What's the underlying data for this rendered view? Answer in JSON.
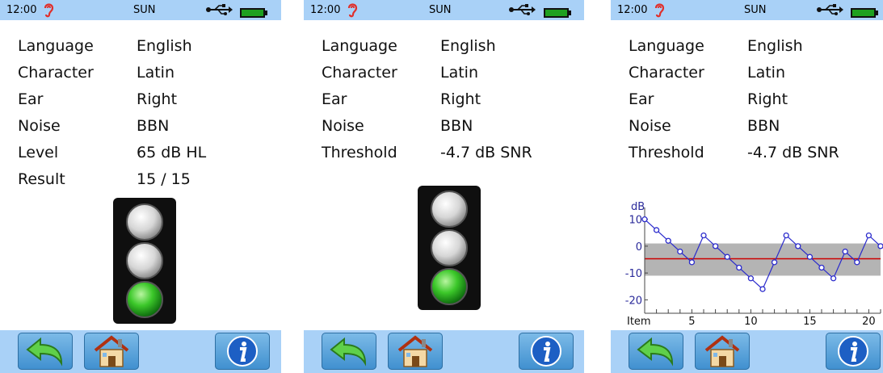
{
  "status": {
    "time": "12:00",
    "day": "SUN",
    "ear_icon": "ear-icon",
    "usb_icon": "usb-icon",
    "battery_color": "#1a8a1a"
  },
  "screen1": {
    "rows": [
      {
        "label": "Language",
        "value": "English"
      },
      {
        "label": "Character",
        "value": "Latin"
      },
      {
        "label": "Ear",
        "value": "Right"
      },
      {
        "label": "Noise",
        "value": "BBN"
      },
      {
        "label": "Level",
        "value": "65 dB HL"
      },
      {
        "label": "Result",
        "value": "15 / 15"
      }
    ],
    "traffic_light": [
      "off",
      "off",
      "green"
    ]
  },
  "screen2": {
    "rows": [
      {
        "label": "Language",
        "value": "English"
      },
      {
        "label": "Character",
        "value": "Latin"
      },
      {
        "label": "Ear",
        "value": "Right"
      },
      {
        "label": "Noise",
        "value": "BBN"
      },
      {
        "label": "Threshold",
        "value": "-4.7 dB SNR"
      }
    ],
    "traffic_light": [
      "off",
      "off",
      "green"
    ]
  },
  "screen3": {
    "rows": [
      {
        "label": "Language",
        "value": "English"
      },
      {
        "label": "Character",
        "value": "Latin"
      },
      {
        "label": "Ear",
        "value": "Right"
      },
      {
        "label": "Noise",
        "value": "BBN"
      },
      {
        "label": "Threshold",
        "value": "-4.7 dB SNR"
      }
    ]
  },
  "toolbar": {
    "back_icon": "back-arrow-icon",
    "home_icon": "home-icon",
    "info_icon": "info-icon"
  },
  "chart_data": {
    "type": "line",
    "ylabel": "dB",
    "xlabel": "Item",
    "y_ticks": [
      "10",
      "0",
      "-10",
      "-20"
    ],
    "x_ticks": [
      "5",
      "10",
      "15",
      "20"
    ],
    "ylim": [
      -25,
      12
    ],
    "xlim": [
      1,
      21
    ],
    "threshold": -4.7,
    "band": [
      -11,
      1
    ],
    "x": [
      1,
      2,
      3,
      4,
      5,
      6,
      7,
      8,
      9,
      10,
      11,
      12,
      13,
      14,
      15,
      16,
      17,
      18,
      19,
      20,
      21
    ],
    "values": [
      10,
      6,
      2,
      -2,
      -6,
      4,
      0,
      -4,
      -8,
      -12,
      -16,
      -6,
      4,
      0,
      -4,
      -8,
      -12,
      -2,
      -6,
      4,
      0
    ],
    "line_color": "#2a2acc",
    "threshold_color": "#cc0000",
    "band_color": "#b4b4b4"
  }
}
